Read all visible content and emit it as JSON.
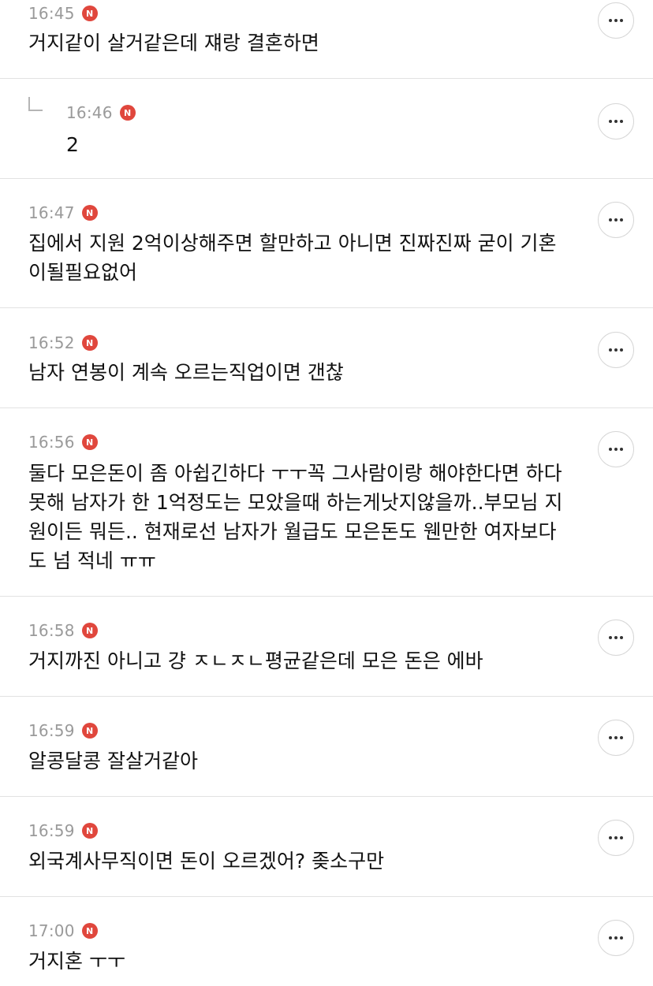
{
  "comments": [
    {
      "time": "16:45",
      "badge": "N",
      "text": "거지같이 살거같은데 쟤랑 결혼하면",
      "reply": false
    },
    {
      "time": "16:46",
      "badge": "N",
      "text": "2",
      "reply": true
    },
    {
      "time": "16:47",
      "badge": "N",
      "text": "집에서 지원 2억이상해주면 할만하고 아니면 진짜진짜 굳이 기혼\n이될필요없어",
      "reply": false
    },
    {
      "time": "16:52",
      "badge": "N",
      "text": "남자 연봉이 계속 오르는직업이면 갠찮",
      "reply": false
    },
    {
      "time": "16:56",
      "badge": "N",
      "text": "둘다 모은돈이 좀 아쉽긴하다 ㅜㅜ꼭 그사람이랑 해야한다면 하다\n못해 남자가 한 1억정도는 모았을때 하는게낫지않을까..부모님 지\n원이든 뭐든.. 현재로선 남자가 월급도 모은돈도 웬만한 여자보다\n도 넘 적네 ㅠㅠ",
      "reply": false
    },
    {
      "time": "16:58",
      "badge": "N",
      "text": "거지까진 아니고 걍 ㅈㄴㅈㄴ평균같은데 모은 돈은 에바",
      "reply": false
    },
    {
      "time": "16:59",
      "badge": "N",
      "text": "알콩달콩 잘살거같아",
      "reply": false
    },
    {
      "time": "16:59",
      "badge": "N",
      "text": "외국계사무직이면 돈이 오르겠어? 좆소구만",
      "reply": false
    },
    {
      "time": "17:00",
      "badge": "N",
      "text": "거지혼 ㅜㅜ",
      "reply": false
    }
  ],
  "icons": {
    "badge_color": "#e0473d",
    "more": "more-options-icon",
    "reply": "reply-arrow-icon"
  }
}
